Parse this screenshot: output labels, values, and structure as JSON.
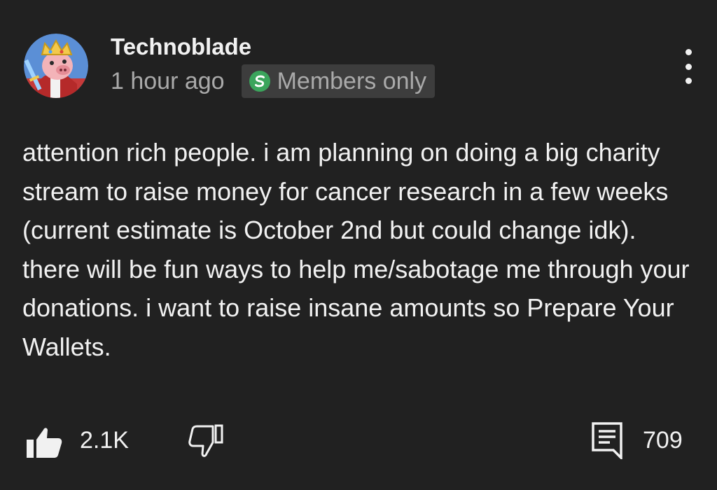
{
  "post": {
    "channel_name": "Technoblade",
    "timestamp": "1 hour ago",
    "badge": {
      "label": "Members only",
      "icon": "members-only-icon",
      "color": "#3ba55c"
    },
    "body": "attention rich people. i am planning on doing a big charity stream to raise money for cancer research in a few weeks (current estimate is October 2nd but could change idk). there will be fun ways to help me/sabotage me through your donations. i want to raise insane amounts so Prepare Your Wallets.",
    "actions": {
      "like_count": "2.1K",
      "comment_count": "709",
      "like_icon": "thumbs-up-icon",
      "dislike_icon": "thumbs-down-icon",
      "comment_icon": "comment-icon",
      "more_icon": "more-vertical-icon"
    }
  },
  "colors": {
    "background": "#212121",
    "text_primary": "#f1f1f1",
    "text_secondary": "#aaaaaa",
    "badge_background": "#3d3d3d"
  }
}
